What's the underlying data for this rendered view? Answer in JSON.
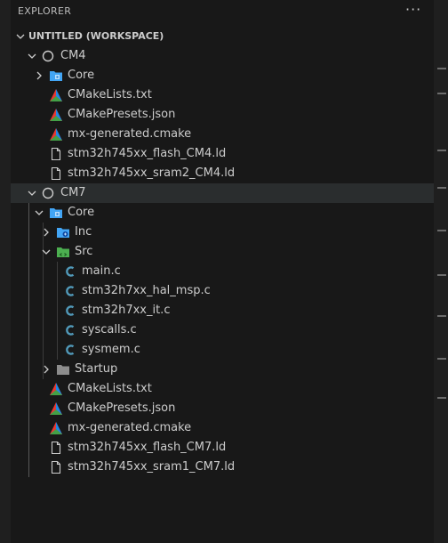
{
  "explorer": {
    "title": "EXPLORER",
    "more_actions": "···",
    "workspace_label": "UNTITLED (WORKSPACE)",
    "tree": [
      {
        "label": "CM4"
      },
      {
        "label": "Core"
      },
      {
        "label": "CMakeLists.txt"
      },
      {
        "label": "CMakePresets.json"
      },
      {
        "label": "mx-generated.cmake"
      },
      {
        "label": "stm32h745xx_flash_CM4.ld"
      },
      {
        "label": "stm32h745xx_sram2_CM4.ld"
      },
      {
        "label": "CM7"
      },
      {
        "label": "Core"
      },
      {
        "label": "Inc"
      },
      {
        "label": "Src"
      },
      {
        "label": "main.c"
      },
      {
        "label": "stm32h7xx_hal_msp.c"
      },
      {
        "label": "stm32h7xx_it.c"
      },
      {
        "label": "syscalls.c"
      },
      {
        "label": "sysmem.c"
      },
      {
        "label": "Startup"
      },
      {
        "label": "CMakeLists.txt"
      },
      {
        "label": "CMakePresets.json"
      },
      {
        "label": "mx-generated.cmake"
      },
      {
        "label": "stm32h745xx_flash_CM7.ld"
      },
      {
        "label": "stm32h745xx_sram1_CM7.ld"
      }
    ]
  },
  "colors": {
    "background": "#181818",
    "selected_row": "#2a2d2e",
    "c_file_icon": "#519aba",
    "folder_blue": "#42a5f5",
    "folder_gray": "#8c8c8c",
    "src_folder_green": "#4caf50",
    "cmake_icon": "#e53935"
  }
}
